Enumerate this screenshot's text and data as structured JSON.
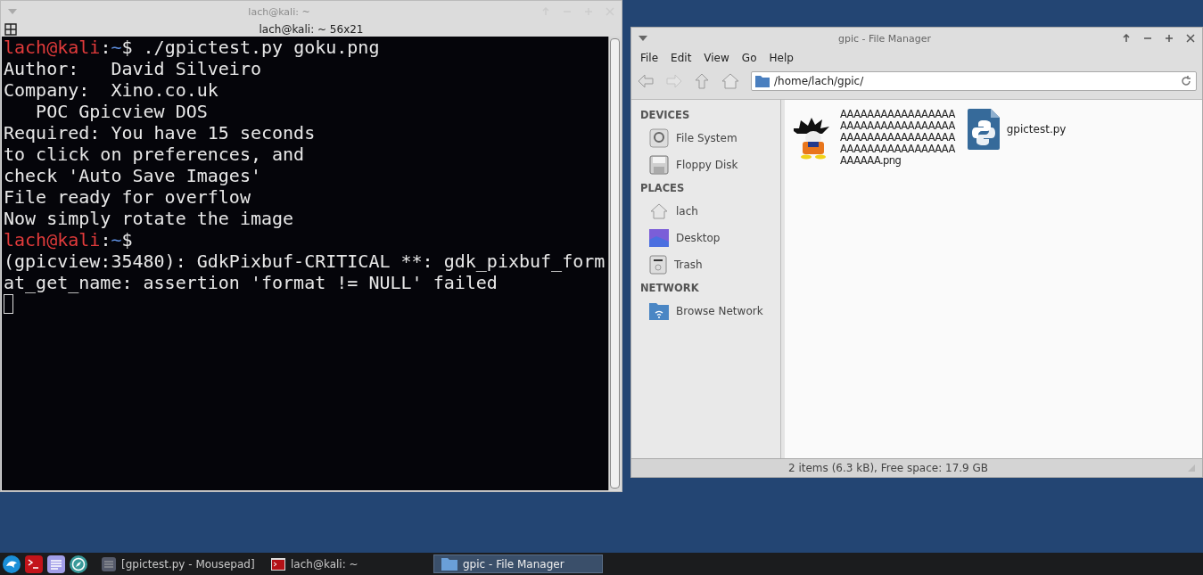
{
  "terminal": {
    "title": "lach@kali: ~",
    "subtitle": "lach@kali: ~ 56x21",
    "lines": [
      [
        {
          "kind": "user",
          "text": "lach@kali"
        },
        {
          "kind": "plain",
          "text": ":"
        },
        {
          "kind": "path",
          "text": "~"
        },
        {
          "kind": "plain",
          "text": "$ ./gpictest.py goku.png"
        }
      ],
      [
        {
          "kind": "plain",
          "text": "Author:   David Silveiro"
        }
      ],
      [
        {
          "kind": "plain",
          "text": "Company:  Xino.co.uk"
        }
      ],
      [
        {
          "kind": "plain",
          "text": "   POC Gpicview DOS"
        }
      ],
      [
        {
          "kind": "plain",
          "text": "Required: You have 15 seconds"
        }
      ],
      [
        {
          "kind": "plain",
          "text": "to click on preferences, and"
        }
      ],
      [
        {
          "kind": "plain",
          "text": "check 'Auto Save Images'"
        }
      ],
      [
        {
          "kind": "plain",
          "text": "File ready for overflow"
        }
      ],
      [
        {
          "kind": "plain",
          "text": "Now simply rotate the image"
        }
      ],
      [
        {
          "kind": "user",
          "text": "lach@kali"
        },
        {
          "kind": "plain",
          "text": ":"
        },
        {
          "kind": "path",
          "text": "~"
        },
        {
          "kind": "plain",
          "text": "$"
        }
      ],
      [
        {
          "kind": "plain",
          "text": "(gpicview:35480): GdkPixbuf-CRITICAL **: gdk_pixbuf_form"
        }
      ],
      [
        {
          "kind": "plain",
          "text": "at_get_name: assertion 'format != NULL' failed"
        }
      ]
    ]
  },
  "file_manager": {
    "title": "gpic - File Manager",
    "menu": [
      "File",
      "Edit",
      "View",
      "Go",
      "Help"
    ],
    "location": "/home/lach/gpic/",
    "sidebar": [
      {
        "heading": "DEVICES",
        "items": [
          {
            "kind": "disk",
            "label": "File System"
          },
          {
            "kind": "floppy",
            "label": "Floppy Disk"
          }
        ]
      },
      {
        "heading": "PLACES",
        "items": [
          {
            "kind": "home",
            "label": "lach"
          },
          {
            "kind": "desktop",
            "label": "Desktop"
          },
          {
            "kind": "trash",
            "label": "Trash"
          }
        ]
      },
      {
        "heading": "NETWORK",
        "items": [
          {
            "kind": "network",
            "label": "Browse Network"
          }
        ]
      }
    ],
    "files": [
      {
        "kind": "picture",
        "lines": [
          "AAAAAAAAAAAAAAAAA",
          "AAAAAAAAAAAAAAAAA",
          "AAAAAAAAAAAAAAAAA",
          "AAAAAAAAAAAAAAAAA",
          "AAAAAA.png"
        ]
      },
      {
        "kind": "python",
        "lines": [
          "gpictest.py"
        ]
      }
    ],
    "status": "2 items (6.3 kB), Free space: 17.9 GB"
  },
  "taskbar": {
    "tasks": [
      {
        "kind": "editor",
        "label": "[gpictest.py - Mousepad]",
        "selected": false
      },
      {
        "kind": "terminal",
        "label": "lach@kali: ~",
        "selected": false
      },
      {
        "kind": "folder",
        "label": "gpic - File Manager",
        "selected": true
      }
    ]
  }
}
